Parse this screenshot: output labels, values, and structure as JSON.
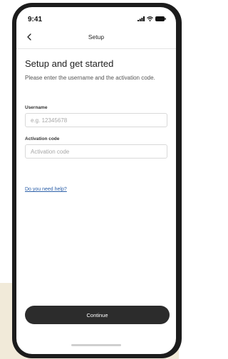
{
  "status_bar": {
    "time": "9:41"
  },
  "nav": {
    "title": "Setup"
  },
  "content": {
    "title": "Setup and get started",
    "description": "Please enter the username and the activation code."
  },
  "form": {
    "username": {
      "label": "Username",
      "placeholder": "e.g. 12345678",
      "value": ""
    },
    "activation": {
      "label": "Activation code",
      "placeholder": "Activation code",
      "value": ""
    }
  },
  "help_link": "Do you need help?",
  "footer": {
    "continue_label": "Continue"
  },
  "colors": {
    "link": "#2b5fa8",
    "button": "#2c2c2c",
    "background_tint": "#f1ead9"
  },
  "icons": [
    "signal-icon",
    "wifi-icon",
    "battery-icon",
    "back-chevron-icon"
  ]
}
